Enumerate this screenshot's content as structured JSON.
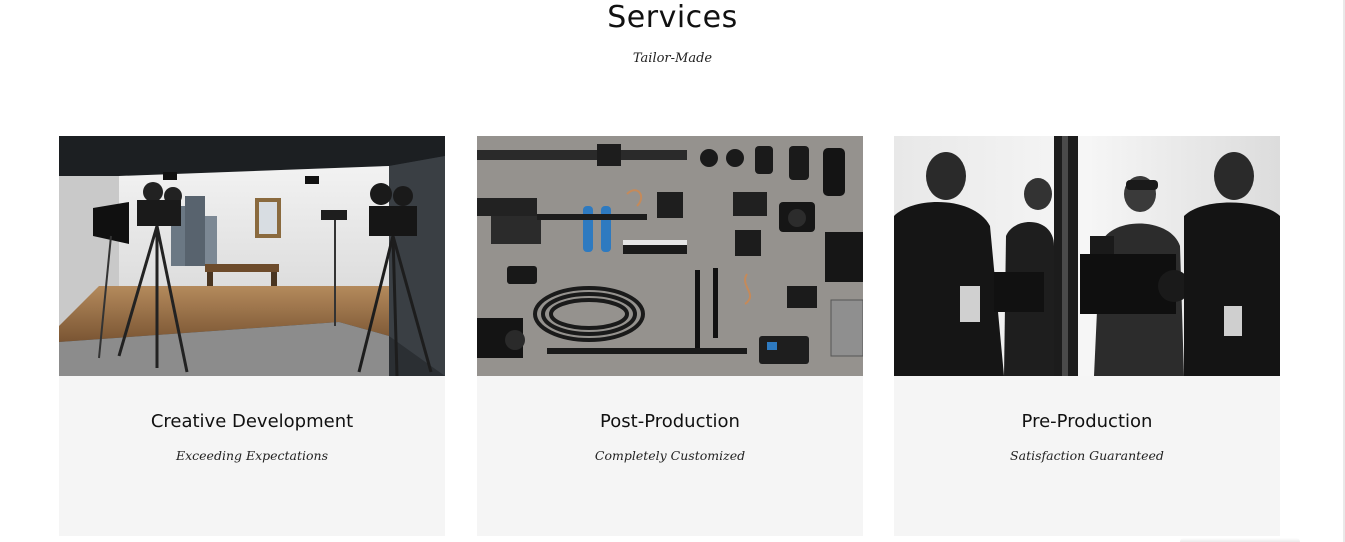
{
  "header": {
    "title": "Services",
    "subtitle": "Tailor-Made"
  },
  "cards": [
    {
      "title": "Creative Development",
      "subtitle": "Exceeding Expectations",
      "image": "film-studio-photo"
    },
    {
      "title": "Post-Production",
      "subtitle": "Completely Customized",
      "image": "camera-gear-flatlay-photo"
    },
    {
      "title": "Pre-Production",
      "subtitle": "Satisfaction Guaranteed",
      "image": "camera-operator-bw-photo"
    }
  ]
}
